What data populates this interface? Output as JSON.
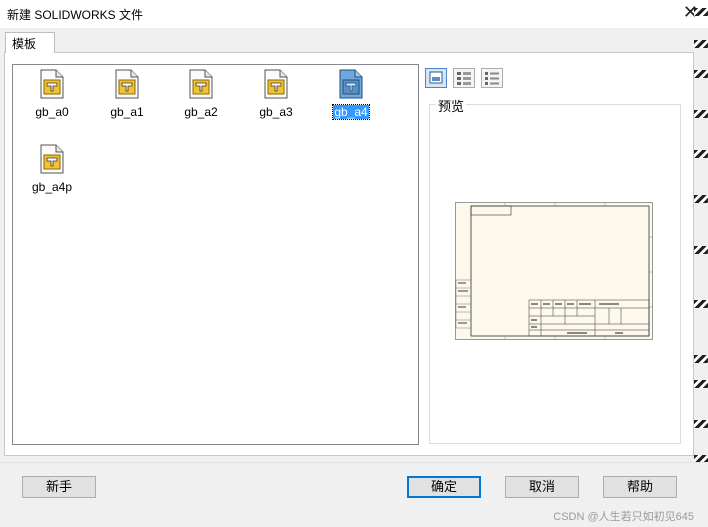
{
  "window": {
    "title": "新建 SOLIDWORKS 文件"
  },
  "tabs": [
    {
      "label": "模板"
    }
  ],
  "templates": [
    {
      "name": "gb_a0",
      "selected": false
    },
    {
      "name": "gb_a1",
      "selected": false
    },
    {
      "name": "gb_a2",
      "selected": false
    },
    {
      "name": "gb_a3",
      "selected": false
    },
    {
      "name": "gb_a4",
      "selected": true
    },
    {
      "name": "gb_a4p",
      "selected": false
    }
  ],
  "view_buttons": [
    {
      "icon": "large-icons-view-icon",
      "active": true
    },
    {
      "icon": "list-view-icon",
      "active": false
    },
    {
      "icon": "details-view-icon",
      "active": false
    }
  ],
  "preview": {
    "label": "预览"
  },
  "buttons": {
    "novice": "新手",
    "ok": "确定",
    "cancel": "取消",
    "help": "帮助"
  },
  "watermark": "CSDN @人生若只如初见645",
  "colors": {
    "selection": "#3399ff",
    "default_button_border": "#0078d7",
    "sheet_bg": "#fdf8ec"
  }
}
